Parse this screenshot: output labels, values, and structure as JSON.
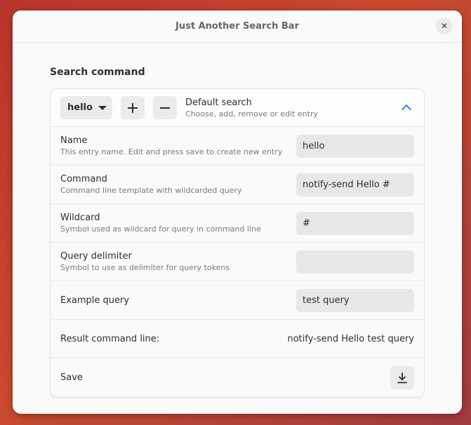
{
  "window": {
    "title": "Just Another Search Bar"
  },
  "section": {
    "title": "Search command"
  },
  "header": {
    "selected_entry": "hello",
    "title": "Default search",
    "subtitle": "Choose, add, remove or edit entry"
  },
  "rows": [
    {
      "title": "Name",
      "subtitle": "This entry name. Edit and press save to create new entry",
      "value": "hello"
    },
    {
      "title": "Command",
      "subtitle": "Command line template with wildcarded query",
      "value": "notify-send Hello #"
    },
    {
      "title": "Wildcard",
      "subtitle": "Symbol used as wildcard for query in command line",
      "value": "#"
    },
    {
      "title": "Query delimiter",
      "subtitle": "Symbol to use as delimiter for query tokens",
      "value": ""
    },
    {
      "title": "Example query",
      "value": "test query"
    }
  ],
  "result": {
    "label": "Result command line:",
    "value": "notify-send Hello test query"
  },
  "save": {
    "label": "Save"
  },
  "colors": {
    "accent": "#3584e4",
    "background": "#c94a2e"
  },
  "icons": [
    "close-icon",
    "dropdown-caret-icon",
    "add-icon",
    "remove-icon",
    "chevron-up-icon",
    "download-icon"
  ]
}
